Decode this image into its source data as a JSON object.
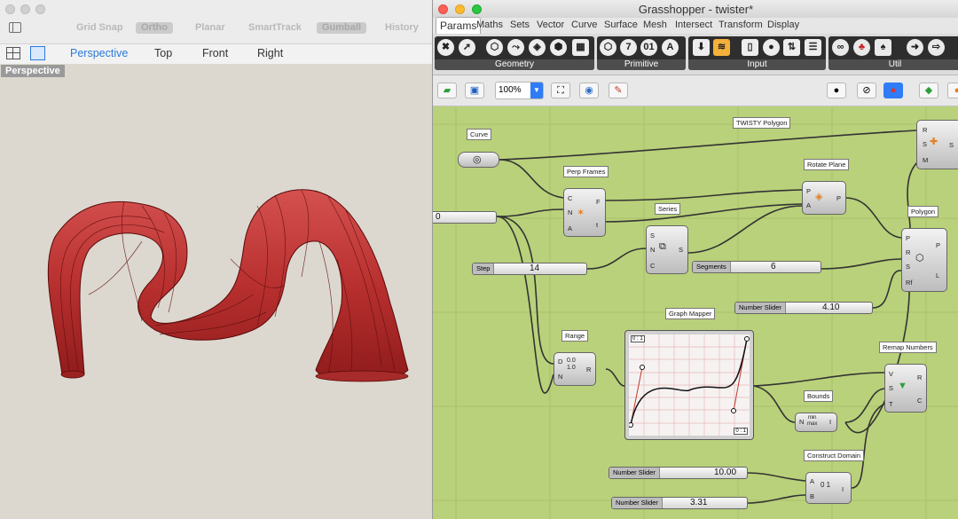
{
  "rhino": {
    "snap_bar": [
      "Grid Snap",
      "Ortho",
      "Planar",
      "SmartTrack",
      "Gumball",
      "History"
    ],
    "views": [
      "Perspective",
      "Top",
      "Front",
      "Right"
    ],
    "viewport_label": "Perspective"
  },
  "gh": {
    "title": "Grasshopper - twister*",
    "tabs": [
      "Params",
      "Maths",
      "Sets",
      "Vector",
      "Curve",
      "Surface",
      "Mesh",
      "Intersect",
      "Transform",
      "Display"
    ],
    "ribbon": {
      "geometry": "Geometry",
      "primitive": "Primitive",
      "input": "Input",
      "util": "Util"
    },
    "zoom": "100%",
    "components": {
      "twisty": "TWISTY Polygon",
      "curve": "Curve",
      "perp_frames": "Perp Frames",
      "rotate_plane": "Rotate Plane",
      "series": "Series",
      "polygon": "Polygon",
      "range": "Range",
      "graph_mapper": "Graph Mapper",
      "remap": "Remap Numbers",
      "bounds": "Bounds",
      "construct_domain": "Construct Domain"
    },
    "sliders": {
      "zero": {
        "value": "0"
      },
      "step": {
        "label": "Step",
        "value": "14"
      },
      "segments": {
        "label": "Segments",
        "value": "6"
      },
      "n1": {
        "label": "Number Slider",
        "value": "4.10"
      },
      "n2": {
        "label": "Number Slider",
        "value": "10.00"
      },
      "n3": {
        "label": "Number Slider",
        "value": "3.31"
      }
    },
    "graph": {
      "tl": "0 : 1",
      "br": "0 : 1"
    },
    "ports": {
      "twisty": [
        "R",
        "S",
        "M",
        "S"
      ],
      "perp": [
        "C",
        "N",
        "A",
        "F",
        "t"
      ],
      "rotate": [
        "P",
        "A",
        "P"
      ],
      "series": [
        "S",
        "N",
        "C",
        "S"
      ],
      "polygon": [
        "P",
        "R",
        "S",
        "Rf",
        "P",
        "L"
      ],
      "range": [
        "D",
        "N",
        "R"
      ],
      "remap": [
        "V",
        "S",
        "T",
        "R",
        "C"
      ],
      "bounds": [
        "N",
        "I"
      ],
      "domain": [
        "A",
        "B",
        "I"
      ]
    },
    "icon_text": {
      "range": "0.0\n1.0",
      "bounds": "min\nmax",
      "domain": "0 1"
    }
  }
}
